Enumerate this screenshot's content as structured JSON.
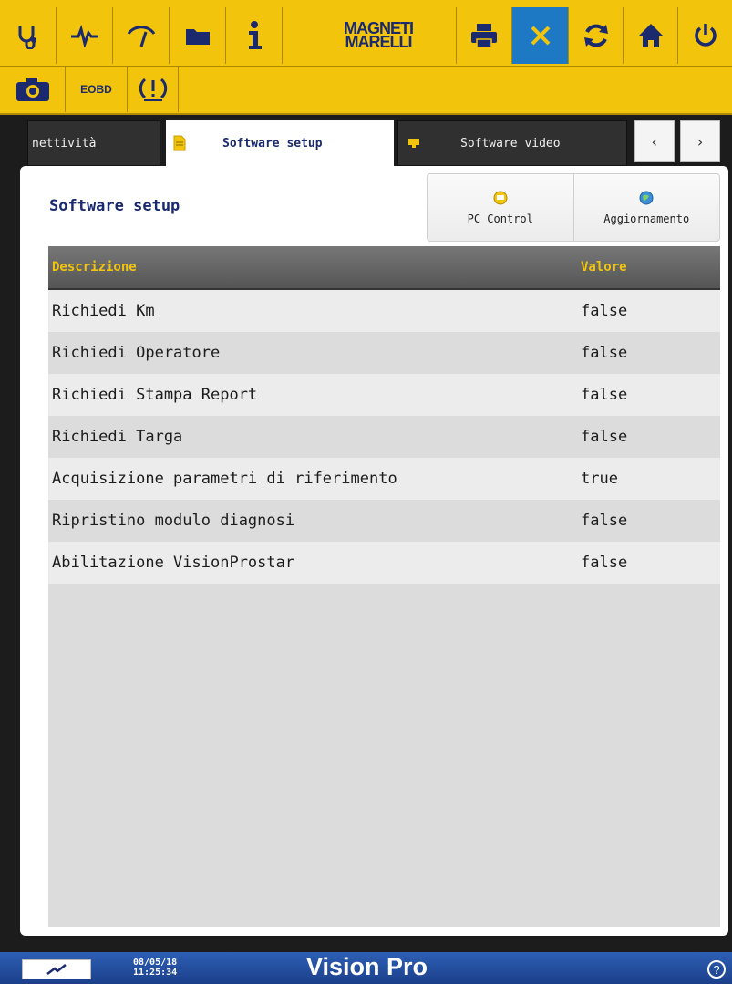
{
  "toolbar": {
    "icons": [
      "stethoscope-icon",
      "ecg-icon",
      "gauge-icon",
      "folder-icon",
      "info-icon",
      "printer-icon",
      "tools-icon",
      "refresh-icon",
      "home-icon",
      "power-icon"
    ],
    "logo_line1": "MAGNETI",
    "logo_line2": "MARELLI",
    "eobd_label": "EOBD",
    "secondary_icons": [
      "camera-icon",
      "tpms-warning-icon"
    ],
    "accent_color": "#f2c40c",
    "active_color": "#1d79c4"
  },
  "tabs": [
    {
      "label": "nettività",
      "icon": "connection-icon"
    },
    {
      "label": "Software setup",
      "icon": "document-icon",
      "active": true
    },
    {
      "label": "Software video",
      "icon": "monitor-icon"
    }
  ],
  "tab_nav": {
    "prev": "‹",
    "next": "›"
  },
  "panel": {
    "title": "Software setup",
    "actions": [
      {
        "label": "PC Control",
        "icon": "pc-control-icon"
      },
      {
        "label": "Aggiornamento",
        "icon": "update-globe-icon"
      }
    ]
  },
  "table": {
    "headers": {
      "description": "Descrizione",
      "value": "Valore"
    },
    "rows": [
      {
        "description": "Richiedi Km",
        "value": "false"
      },
      {
        "description": "Richiedi Operatore",
        "value": "false"
      },
      {
        "description": "Richiedi Stampa Report",
        "value": "false"
      },
      {
        "description": "Richiedi Targa",
        "value": "false"
      },
      {
        "description": "Acquisizione parametri di riferimento",
        "value": "true"
      },
      {
        "description": "Ripristino modulo diagnosi",
        "value": "false"
      },
      {
        "description": "Abilitazione VisionProstar",
        "value": "false"
      }
    ]
  },
  "statusbar": {
    "date": "08/05/18",
    "time": "11:25:34",
    "product": "Vision Pro",
    "help_symbol": "?"
  }
}
